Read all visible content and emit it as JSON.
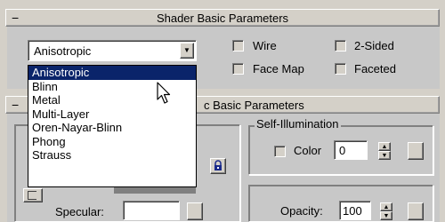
{
  "shader_rollout": {
    "collapse_symbol": "−",
    "title": "Shader Basic Parameters",
    "shader_select": {
      "value": "Anisotropic",
      "arrow": "▼"
    },
    "checkboxes": {
      "wire": "Wire",
      "two_sided": "2-Sided",
      "face_map": "Face Map",
      "faceted": "Faceted"
    },
    "shader_options": [
      "Anisotropic",
      "Blinn",
      "Metal",
      "Multi-Layer",
      "Oren-Nayar-Blinn",
      "Phong",
      "Strauss"
    ],
    "selected_option": "Anisotropic"
  },
  "basic_rollout": {
    "collapse_symbol": "−",
    "title": "c Basic Parameters",
    "self_illumination": {
      "title": "Self-Illumination",
      "color_label": "Color",
      "color_value": "0"
    },
    "specular_label": "Specular:",
    "opacity_label": "Opacity:",
    "opacity_value": "100"
  },
  "icons": {
    "lock": "lock-icon",
    "cursor": "cursor-icon"
  },
  "colors": {
    "selection": "#0a246a",
    "panel": "#d4d0c8"
  }
}
